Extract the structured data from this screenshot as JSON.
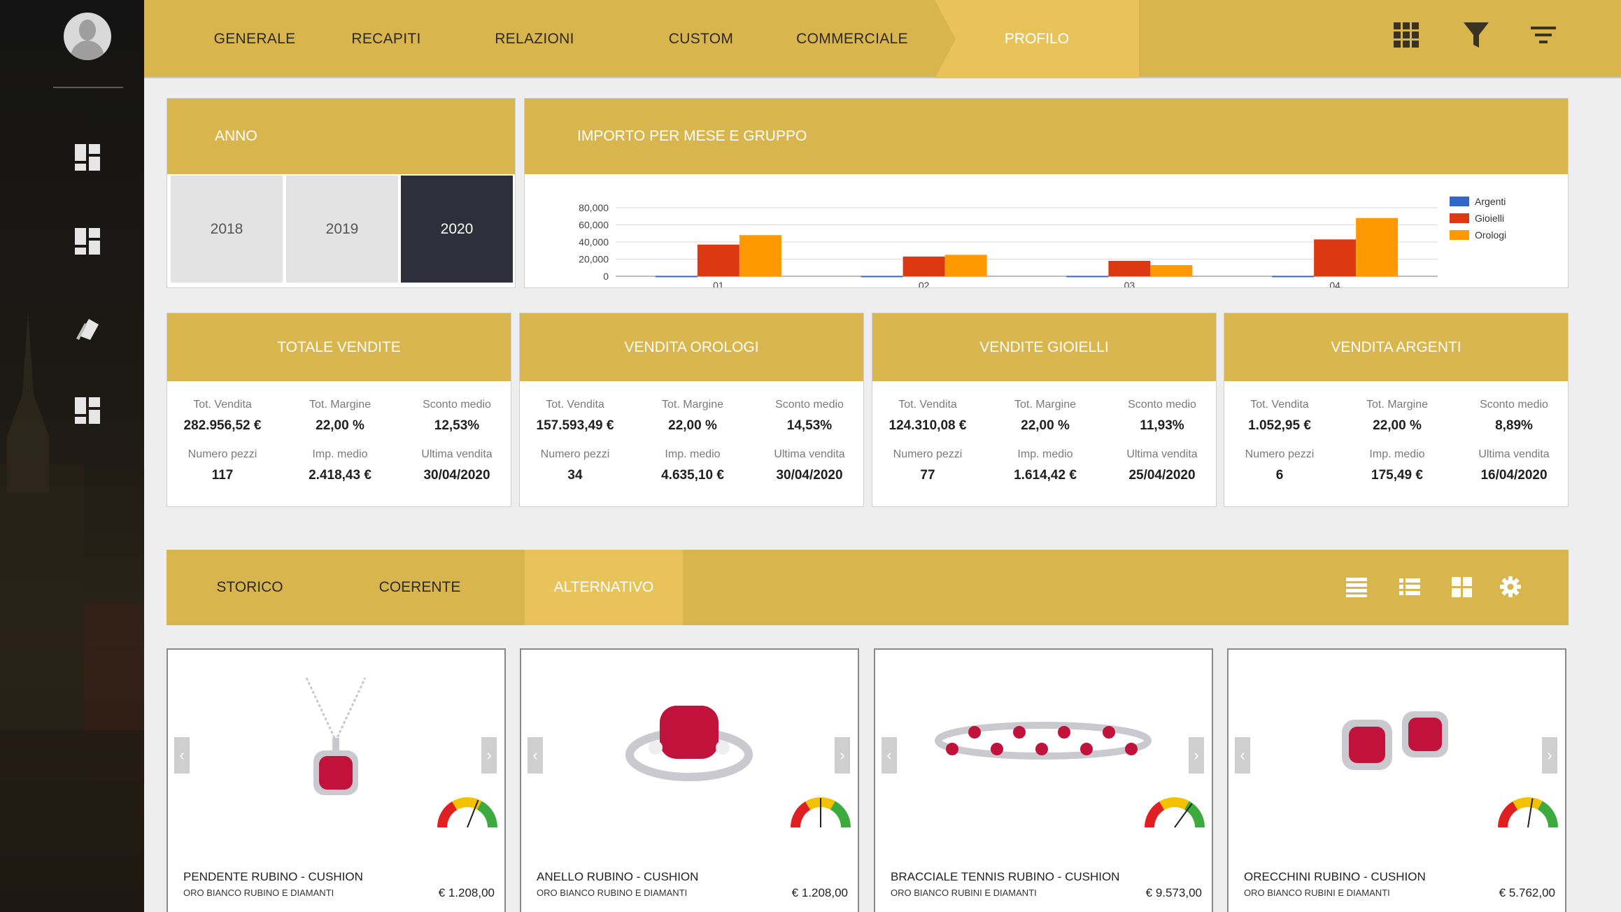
{
  "sidebar": {
    "items": [
      {
        "icon": "dashboard-icon"
      },
      {
        "icon": "dashboard-icon"
      },
      {
        "icon": "tags-icon"
      },
      {
        "icon": "dashboard-icon"
      }
    ]
  },
  "topbar": {
    "tabs": [
      "GENERALE",
      "RECAPITI",
      "RELAZIONI",
      "CUSTOM",
      "COMMERCIALE",
      "PROFILO"
    ],
    "active_tab": "PROFILO",
    "icons": [
      "grid-icon",
      "filter-icon",
      "sort-icon"
    ]
  },
  "anno": {
    "title": "ANNO",
    "years": [
      "2018",
      "2019",
      "2020"
    ],
    "selected": "2020"
  },
  "chart_panel": {
    "title": "IMPORTO PER MESE E GRUPPO"
  },
  "chart_data": {
    "type": "bar",
    "categories": [
      "01",
      "02",
      "03",
      "04"
    ],
    "series": [
      {
        "name": "Argenti",
        "values": [
          500,
          500,
          500,
          500
        ],
        "color": "#3366cc"
      },
      {
        "name": "Gioielli",
        "values": [
          37000,
          23000,
          18000,
          43000
        ],
        "color": "#dc3912"
      },
      {
        "name": "Orologi",
        "values": [
          48000,
          25000,
          13000,
          68000
        ],
        "color": "#ff9900"
      }
    ],
    "yticks": [
      "80,000",
      "60,000",
      "40,000",
      "20,000",
      "0"
    ],
    "ylim": [
      0,
      80000
    ],
    "legend": "right"
  },
  "kpis": [
    {
      "title": "TOTALE VENDITE",
      "tot_vendita": "282.956,52 €",
      "tot_margine": "22,00 %",
      "sconto_medio": "12,53%",
      "numero_pezzi": "117",
      "imp_medio": "2.418,43 €",
      "ultima_vendita": "30/04/2020"
    },
    {
      "title": "VENDITA OROLOGI",
      "tot_vendita": "157.593,49 €",
      "tot_margine": "22,00 %",
      "sconto_medio": "14,53%",
      "numero_pezzi": "34",
      "imp_medio": "4.635,10 €",
      "ultima_vendita": "30/04/2020"
    },
    {
      "title": "VENDITE GIOIELLI",
      "tot_vendita": "124.310,08 €",
      "tot_margine": "22,00 %",
      "sconto_medio": "11,93%",
      "numero_pezzi": "77",
      "imp_medio": "1.614,42 €",
      "ultima_vendita": "25/04/2020"
    },
    {
      "title": "VENDITA ARGENTI",
      "tot_vendita": "1.052,95 €",
      "tot_margine": "22,00 %",
      "sconto_medio": "8,89%",
      "numero_pezzi": "6",
      "imp_medio": "175,49 €",
      "ultima_vendita": "16/04/2020"
    }
  ],
  "kpi_labels": {
    "tot_vendita": "Tot. Vendita",
    "tot_margine": "Tot. Margine",
    "sconto_medio": "Sconto medio",
    "numero_pezzi": "Numero pezzi",
    "imp_medio": "Imp. medio",
    "ultima_vendita": "Ultima vendita"
  },
  "subtabs": {
    "tabs": [
      "STORICO",
      "COERENTE",
      "ALTERNATIVO"
    ],
    "active": "ALTERNATIVO",
    "view_icons": [
      "list-view-icon",
      "detail-list-icon",
      "grid-view-icon",
      "settings-icon"
    ]
  },
  "products": [
    {
      "name": "PENDENTE RUBINO - CUSHION",
      "desc": "ORO BIANCO RUBINO E DIAMANTI",
      "price": "€ 1.208,00",
      "icon": "pendant-image",
      "gauge_level": 0.62
    },
    {
      "name": "ANELLO RUBINO - CUSHION",
      "desc": "ORO BIANCO RUBINO E DIAMANTI",
      "price": "€ 1.208,00",
      "icon": "ring-image",
      "gauge_level": 0.5
    },
    {
      "name": "BRACCIALE TENNIS RUBINO - CUSHION",
      "desc": "ORO BIANCO RUBINI E DIAMANTI",
      "price": "€ 9.573,00",
      "icon": "bracelet-image",
      "gauge_level": 0.7
    },
    {
      "name": "ORECCHINI RUBINO - CUSHION",
      "desc": "ORO BIANCO RUBINI E DIAMANTI",
      "price": "€ 5.762,00",
      "icon": "earrings-image",
      "gauge_level": 0.55
    }
  ]
}
